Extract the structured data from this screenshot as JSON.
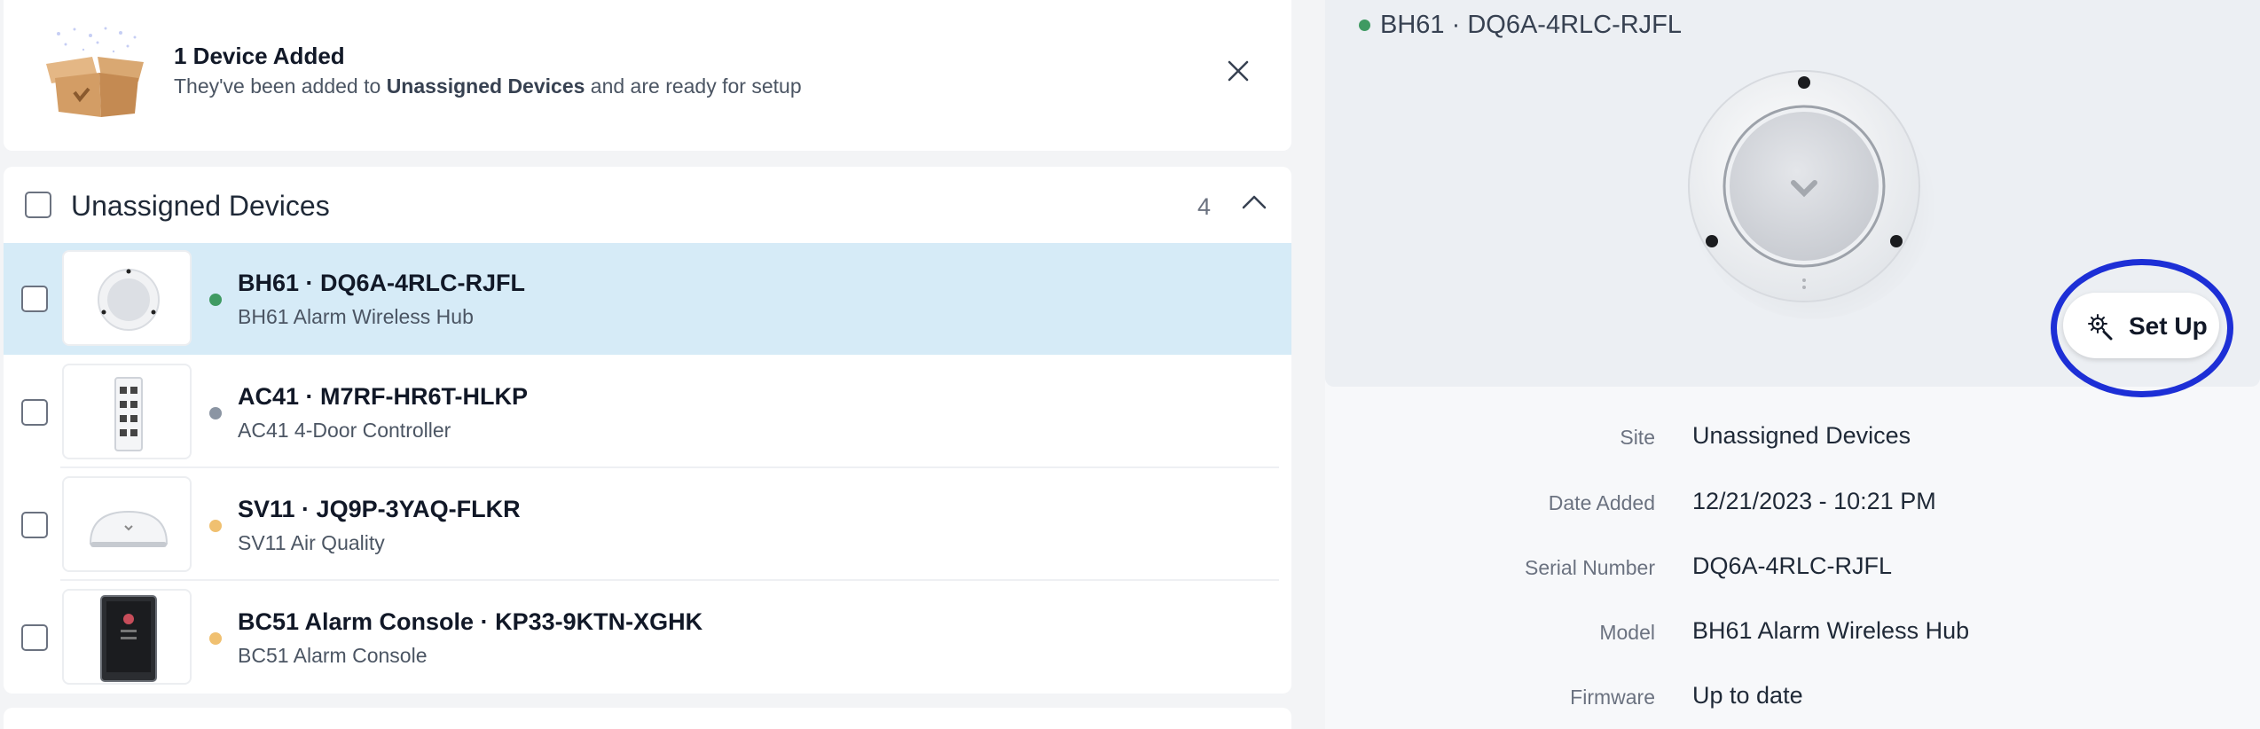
{
  "banner": {
    "title": "1 Device Added",
    "sub_prefix": "They've been added to ",
    "sub_bold": "Unassigned Devices",
    "sub_suffix": " and are ready for setup"
  },
  "list": {
    "title": "Unassigned Devices",
    "count": "4",
    "devices": [
      {
        "title": "BH61 · DQ6A-4RLC-RJFL",
        "subtitle": "BH61 Alarm Wireless Hub",
        "status_color": "#3f9a62",
        "selected": true
      },
      {
        "title": "AC41 · M7RF-HR6T-HLKP",
        "subtitle": "AC41 4-Door Controller",
        "status_color": "#8b95a3",
        "selected": false
      },
      {
        "title": "SV11 · JQ9P-3YAQ-FLKR",
        "subtitle": "SV11 Air Quality",
        "status_color": "#f0c070",
        "selected": false
      },
      {
        "title": "BC51 Alarm Console · KP33-9KTN-XGHK",
        "subtitle": "BC51 Alarm Console",
        "status_color": "#f0c070",
        "selected": false
      }
    ]
  },
  "detail": {
    "title": "BH61 · DQ6A-4RLC-RJFL",
    "status_color": "#3f9a62",
    "setup_label": "Set Up",
    "fields": [
      {
        "label": "Site",
        "value": "Unassigned Devices"
      },
      {
        "label": "Date Added",
        "value": "12/21/2023 - 10:21 PM"
      },
      {
        "label": "Serial Number",
        "value": "DQ6A-4RLC-RJFL"
      },
      {
        "label": "Model",
        "value": "BH61 Alarm Wireless Hub"
      },
      {
        "label": "Firmware",
        "value": "Up to date"
      }
    ]
  },
  "colors": {
    "selected_row": "#d6ebf7",
    "highlight_ring": "#1d2fd6"
  }
}
